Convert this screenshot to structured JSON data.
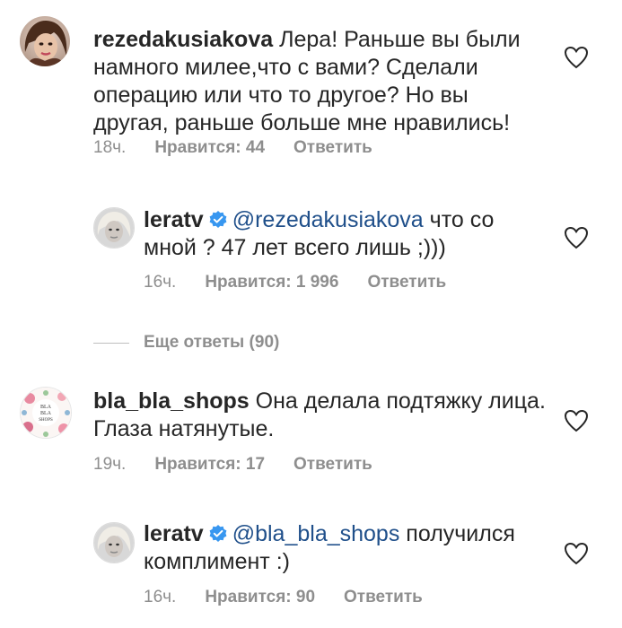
{
  "comments": [
    {
      "username": "rezedakusiakova",
      "text": "Лера! Раньше вы были намного милее,что с вами? Сделали операцию или что то другое? Но вы другая, раньше больше мне нравились!",
      "time": "18ч.",
      "likes": "Нравится: 44",
      "reply": "Ответить",
      "icon": "heart-outline-icon"
    },
    {
      "username": "leratv",
      "verified": true,
      "mention": "@rezedakusiakova",
      "text": "что со мной ? 47 лет всего лишь ;)))",
      "time": "16ч.",
      "likes": "Нравится: 1 996",
      "reply": "Ответить",
      "icon": "heart-outline-icon"
    },
    {
      "username": "bla_bla_shops",
      "text": "Она делала подтяжку лица. Глаза натянутые.",
      "time": "19ч.",
      "likes": "Нравится: 17",
      "reply": "Ответить",
      "icon": "heart-outline-icon",
      "avatar_text": "BLA BLA SHOPS"
    },
    {
      "username": "leratv",
      "verified": true,
      "mention": "@bla_bla_shops",
      "text": "получился комплимент :)",
      "time": "16ч.",
      "likes": "Нравится: 90",
      "reply": "Ответить",
      "icon": "heart-outline-icon"
    }
  ],
  "more_replies": "Еще ответы (90)",
  "colors": {
    "text": "#262626",
    "secondary": "#8e8e8e",
    "mention": "#1f4f8a",
    "verified": "#3897f0"
  }
}
